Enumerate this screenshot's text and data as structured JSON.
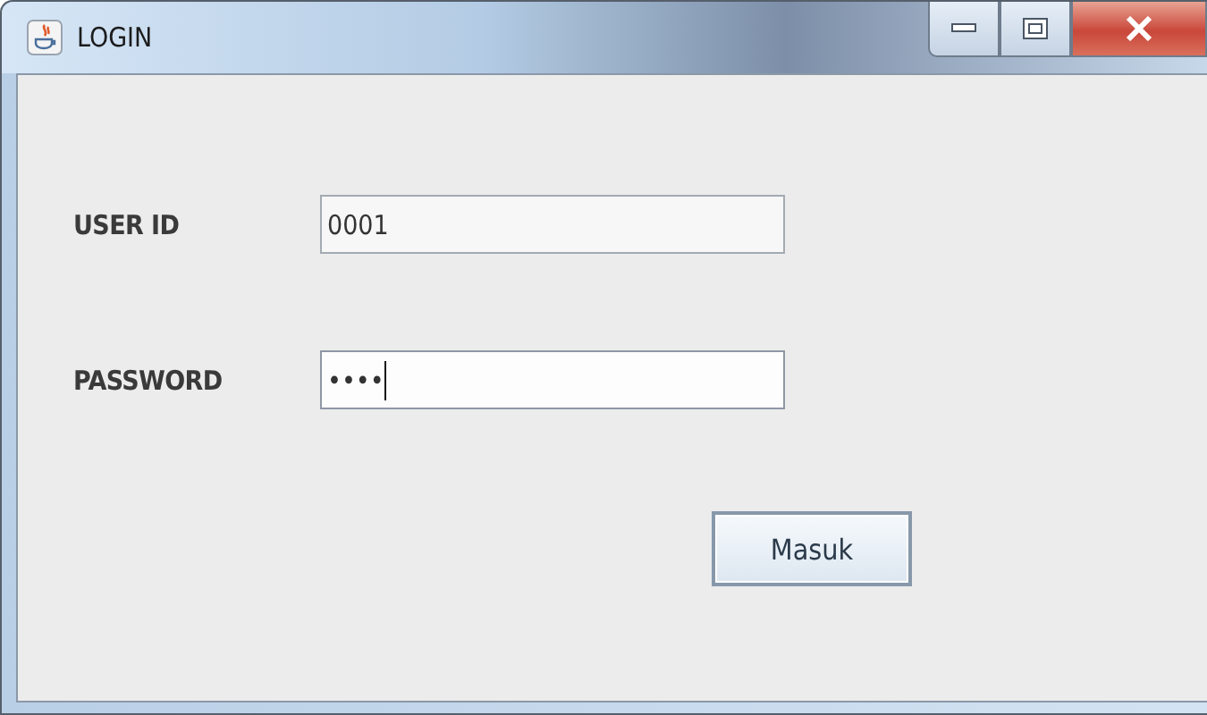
{
  "window": {
    "title": "LOGIN"
  },
  "fields": [
    {
      "label": "USER ID",
      "value": "0001",
      "focused": false
    },
    {
      "label": "PASSWORD",
      "value": "••••",
      "focused": true
    }
  ],
  "buttons": [
    "Masuk"
  ]
}
